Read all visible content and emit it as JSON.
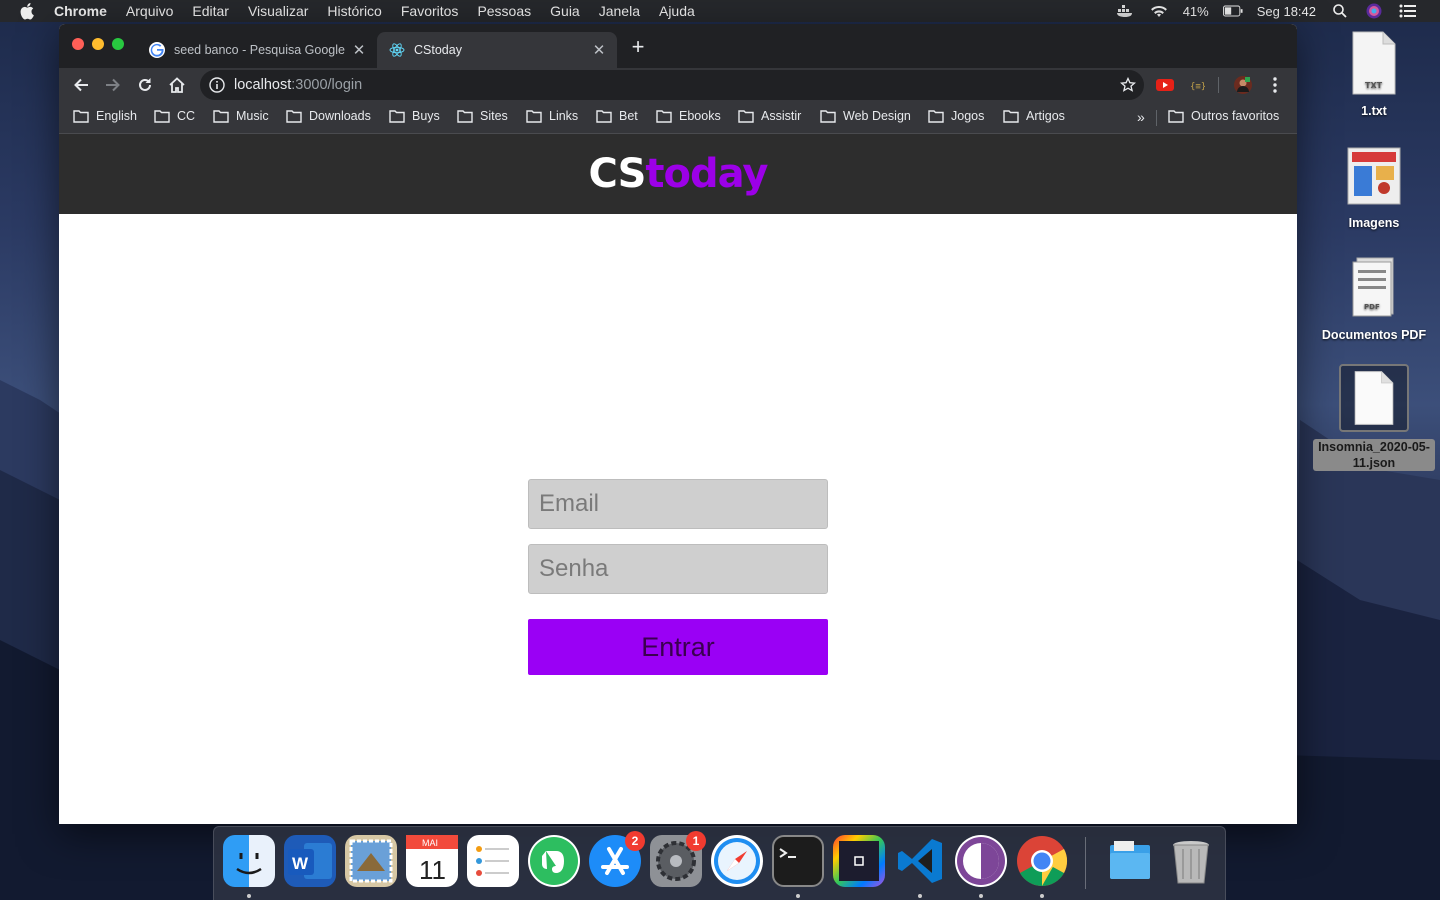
{
  "menubar": {
    "app_name": "Chrome",
    "items": [
      "Arquivo",
      "Editar",
      "Visualizar",
      "Histórico",
      "Favoritos",
      "Pessoas",
      "Guia",
      "Janela",
      "Ajuda"
    ],
    "battery": "41%",
    "clock": "Seg 18:42"
  },
  "browser": {
    "tabs": [
      {
        "title": "seed banco - Pesquisa Google",
        "active": false
      },
      {
        "title": "CStoday",
        "active": true
      }
    ],
    "url_host": "localhost",
    "url_path": ":3000/login",
    "bookmarks": [
      "English",
      "CC",
      "Music",
      "Downloads",
      "Buys",
      "Sites",
      "Links",
      "Bet",
      "Ebooks",
      "Assistir",
      "Web Design",
      "Jogos",
      "Artigos"
    ],
    "other_bookmarks": "Outros favoritos",
    "more_bookmarks": "»"
  },
  "site": {
    "logo_part1": "CS",
    "logo_part2": "today",
    "email_placeholder": "Email",
    "password_placeholder": "Senha",
    "login_button": "Entrar",
    "accent_color": "#9a00f5"
  },
  "desktop": {
    "icons": [
      {
        "label": "1.txt",
        "file_tag": "TXT"
      },
      {
        "label": "Imagens"
      },
      {
        "label": "Documentos PDF",
        "file_tag": "PDF"
      },
      {
        "label": "Insomnia_2020-05-11.json"
      }
    ]
  },
  "dock": {
    "apps": [
      "finder",
      "word",
      "mail",
      "calendar",
      "reminders",
      "evernote",
      "app-store",
      "system-preferences",
      "safari",
      "terminal",
      "screen-capture",
      "vscode",
      "tor",
      "chrome",
      "downloads-stack",
      "trash"
    ],
    "calendar_month": "MAI",
    "calendar_day": "11",
    "app_store_badge": "2",
    "system_preferences_badge": "1"
  }
}
